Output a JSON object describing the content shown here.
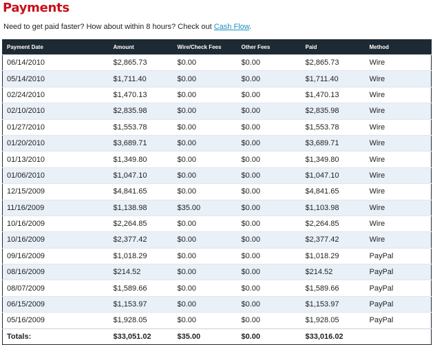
{
  "page": {
    "title": "Payments",
    "intro_text": "Need to get paid faster? How about within 8 hours? Check out ",
    "intro_link": "Cash Flow",
    "intro_end": "."
  },
  "table": {
    "headers": [
      "Payment Date",
      "Amount",
      "Wire/Check Fees",
      "Other Fees",
      "Paid",
      "Method"
    ],
    "rows": [
      [
        "06/14/2010",
        "$2,865.73",
        "$0.00",
        "$0.00",
        "$2,865.73",
        "Wire"
      ],
      [
        "05/14/2010",
        "$1,711.40",
        "$0.00",
        "$0.00",
        "$1,711.40",
        "Wire"
      ],
      [
        "02/24/2010",
        "$1,470.13",
        "$0.00",
        "$0.00",
        "$1,470.13",
        "Wire"
      ],
      [
        "02/10/2010",
        "$2,835.98",
        "$0.00",
        "$0.00",
        "$2,835.98",
        "Wire"
      ],
      [
        "01/27/2010",
        "$1,553.78",
        "$0.00",
        "$0.00",
        "$1,553.78",
        "Wire"
      ],
      [
        "01/20/2010",
        "$3,689.71",
        "$0.00",
        "$0.00",
        "$3,689.71",
        "Wire"
      ],
      [
        "01/13/2010",
        "$1,349.80",
        "$0.00",
        "$0.00",
        "$1,349.80",
        "Wire"
      ],
      [
        "01/06/2010",
        "$1,047.10",
        "$0.00",
        "$0.00",
        "$1,047.10",
        "Wire"
      ],
      [
        "12/15/2009",
        "$4,841.65",
        "$0.00",
        "$0.00",
        "$4,841.65",
        "Wire"
      ],
      [
        "11/16/2009",
        "$1,138.98",
        "$35.00",
        "$0.00",
        "$1,103.98",
        "Wire"
      ],
      [
        "10/16/2009",
        "$2,264.85",
        "$0.00",
        "$0.00",
        "$2,264.85",
        "Wire"
      ],
      [
        "10/16/2009",
        "$2,377.42",
        "$0.00",
        "$0.00",
        "$2,377.42",
        "Wire"
      ],
      [
        "09/16/2009",
        "$1,018.29",
        "$0.00",
        "$0.00",
        "$1,018.29",
        "PayPal"
      ],
      [
        "08/16/2009",
        "$214.52",
        "$0.00",
        "$0.00",
        "$214.52",
        "PayPal"
      ],
      [
        "08/07/2009",
        "$1,589.66",
        "$0.00",
        "$0.00",
        "$1,589.66",
        "PayPal"
      ],
      [
        "06/15/2009",
        "$1,153.97",
        "$0.00",
        "$0.00",
        "$1,153.97",
        "PayPal"
      ],
      [
        "05/16/2009",
        "$1,928.05",
        "$0.00",
        "$0.00",
        "$1,928.05",
        "PayPal"
      ]
    ],
    "totals": [
      "Totals:",
      "$33,051.02",
      "$35.00",
      "$0.00",
      "$33,016.02",
      ""
    ]
  }
}
